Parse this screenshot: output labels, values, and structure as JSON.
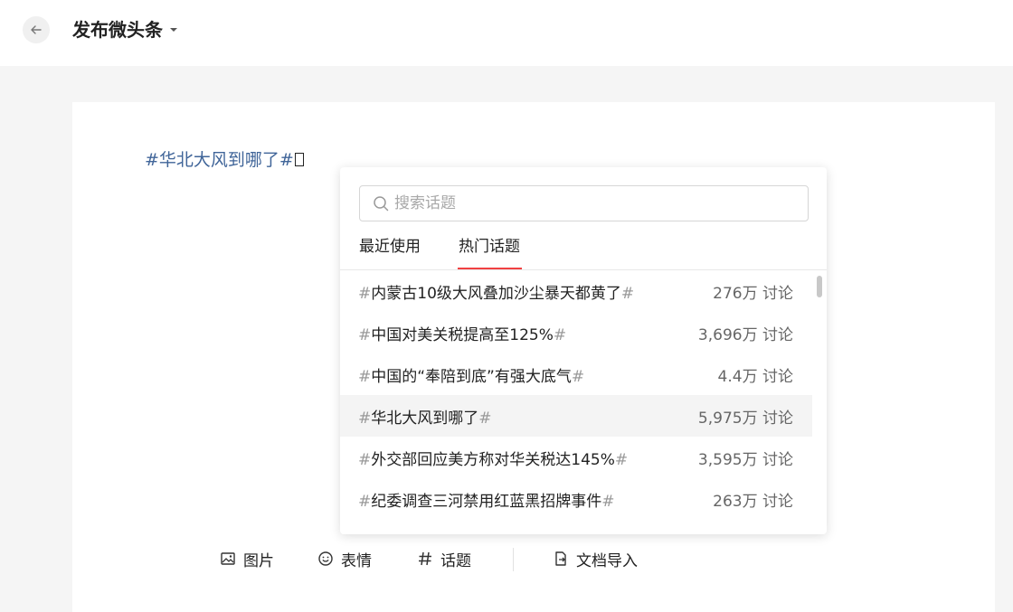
{
  "header": {
    "title": "发布微头条"
  },
  "editor": {
    "text": "#华北大风到哪了#"
  },
  "topic_picker": {
    "search_placeholder": "搜索话题",
    "tabs": [
      {
        "label": "最近使用",
        "active": false
      },
      {
        "label": "热门话题",
        "active": true
      }
    ],
    "discuss_label": "讨论",
    "topics": [
      {
        "name": "内蒙古10级大风叠加沙尘暴天都黄了",
        "count": "276万",
        "highlighted": false
      },
      {
        "name": "中国对美关税提高至125%",
        "count": "3,696万",
        "highlighted": false
      },
      {
        "name": "中国的“奉陪到底”有强大底气",
        "count": "4.4万",
        "highlighted": false
      },
      {
        "name": "华北大风到哪了",
        "count": "5,975万",
        "highlighted": true
      },
      {
        "name": "外交部回应美方称对华关税达145%",
        "count": "3,595万",
        "highlighted": false
      },
      {
        "name": "纪委调查三河禁用红蓝黑招牌事件",
        "count": "263万",
        "highlighted": false
      }
    ]
  },
  "toolbar": {
    "image_label": "图片",
    "emoji_label": "表情",
    "topic_label": "话题",
    "import_label": "文档导入"
  },
  "colors": {
    "accent": "#f04142",
    "topic_link": "#406599",
    "highlight_row": "#f4f4f4"
  }
}
